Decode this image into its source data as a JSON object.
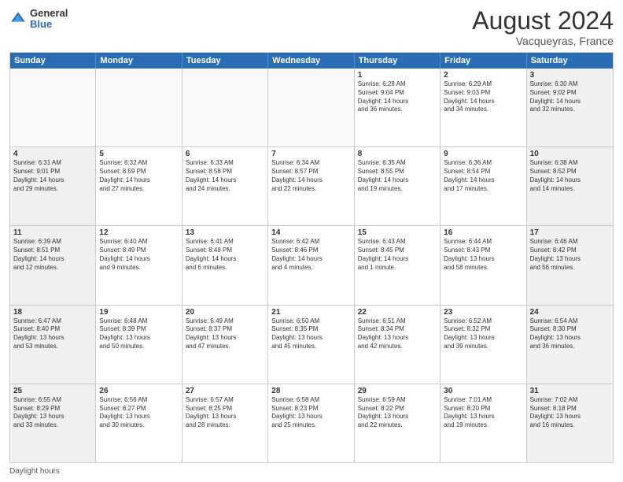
{
  "header": {
    "logo": {
      "general": "General",
      "blue": "Blue"
    },
    "month_year": "August 2024",
    "location": "Vacqueyras, France"
  },
  "days_of_week": [
    "Sunday",
    "Monday",
    "Tuesday",
    "Wednesday",
    "Thursday",
    "Friday",
    "Saturday"
  ],
  "footer": {
    "label": "Daylight hours"
  },
  "weeks": [
    [
      {
        "day": "",
        "info": ""
      },
      {
        "day": "",
        "info": ""
      },
      {
        "day": "",
        "info": ""
      },
      {
        "day": "",
        "info": ""
      },
      {
        "day": "1",
        "info": "Sunrise: 6:28 AM\nSunset: 9:04 PM\nDaylight: 14 hours\nand 36 minutes."
      },
      {
        "day": "2",
        "info": "Sunrise: 6:29 AM\nSunset: 9:03 PM\nDaylight: 14 hours\nand 34 minutes."
      },
      {
        "day": "3",
        "info": "Sunrise: 6:30 AM\nSunset: 9:02 PM\nDaylight: 14 hours\nand 32 minutes."
      }
    ],
    [
      {
        "day": "4",
        "info": "Sunrise: 6:31 AM\nSunset: 9:01 PM\nDaylight: 14 hours\nand 29 minutes."
      },
      {
        "day": "5",
        "info": "Sunrise: 6:32 AM\nSunset: 8:59 PM\nDaylight: 14 hours\nand 27 minutes."
      },
      {
        "day": "6",
        "info": "Sunrise: 6:33 AM\nSunset: 8:58 PM\nDaylight: 14 hours\nand 24 minutes."
      },
      {
        "day": "7",
        "info": "Sunrise: 6:34 AM\nSunset: 8:57 PM\nDaylight: 14 hours\nand 22 minutes."
      },
      {
        "day": "8",
        "info": "Sunrise: 6:35 AM\nSunset: 8:55 PM\nDaylight: 14 hours\nand 19 minutes."
      },
      {
        "day": "9",
        "info": "Sunrise: 6:36 AM\nSunset: 8:54 PM\nDaylight: 14 hours\nand 17 minutes."
      },
      {
        "day": "10",
        "info": "Sunrise: 6:38 AM\nSunset: 8:52 PM\nDaylight: 14 hours\nand 14 minutes."
      }
    ],
    [
      {
        "day": "11",
        "info": "Sunrise: 6:39 AM\nSunset: 8:51 PM\nDaylight: 14 hours\nand 12 minutes."
      },
      {
        "day": "12",
        "info": "Sunrise: 6:40 AM\nSunset: 8:49 PM\nDaylight: 14 hours\nand 9 minutes."
      },
      {
        "day": "13",
        "info": "Sunrise: 6:41 AM\nSunset: 8:48 PM\nDaylight: 14 hours\nand 6 minutes."
      },
      {
        "day": "14",
        "info": "Sunrise: 6:42 AM\nSunset: 8:46 PM\nDaylight: 14 hours\nand 4 minutes."
      },
      {
        "day": "15",
        "info": "Sunrise: 6:43 AM\nSunset: 8:45 PM\nDaylight: 14 hours\nand 1 minute."
      },
      {
        "day": "16",
        "info": "Sunrise: 6:44 AM\nSunset: 8:43 PM\nDaylight: 13 hours\nand 58 minutes."
      },
      {
        "day": "17",
        "info": "Sunrise: 6:46 AM\nSunset: 8:42 PM\nDaylight: 13 hours\nand 56 minutes."
      }
    ],
    [
      {
        "day": "18",
        "info": "Sunrise: 6:47 AM\nSunset: 8:40 PM\nDaylight: 13 hours\nand 53 minutes."
      },
      {
        "day": "19",
        "info": "Sunrise: 6:48 AM\nSunset: 8:39 PM\nDaylight: 13 hours\nand 50 minutes."
      },
      {
        "day": "20",
        "info": "Sunrise: 6:49 AM\nSunset: 8:37 PM\nDaylight: 13 hours\nand 47 minutes."
      },
      {
        "day": "21",
        "info": "Sunrise: 6:50 AM\nSunset: 8:35 PM\nDaylight: 13 hours\nand 45 minutes."
      },
      {
        "day": "22",
        "info": "Sunrise: 6:51 AM\nSunset: 8:34 PM\nDaylight: 13 hours\nand 42 minutes."
      },
      {
        "day": "23",
        "info": "Sunrise: 6:52 AM\nSunset: 8:32 PM\nDaylight: 13 hours\nand 39 minutes."
      },
      {
        "day": "24",
        "info": "Sunrise: 6:54 AM\nSunset: 8:30 PM\nDaylight: 13 hours\nand 36 minutes."
      }
    ],
    [
      {
        "day": "25",
        "info": "Sunrise: 6:55 AM\nSunset: 8:29 PM\nDaylight: 13 hours\nand 33 minutes."
      },
      {
        "day": "26",
        "info": "Sunrise: 6:56 AM\nSunset: 8:27 PM\nDaylight: 13 hours\nand 30 minutes."
      },
      {
        "day": "27",
        "info": "Sunrise: 6:57 AM\nSunset: 8:25 PM\nDaylight: 13 hours\nand 28 minutes."
      },
      {
        "day": "28",
        "info": "Sunrise: 6:58 AM\nSunset: 8:23 PM\nDaylight: 13 hours\nand 25 minutes."
      },
      {
        "day": "29",
        "info": "Sunrise: 6:59 AM\nSunset: 8:22 PM\nDaylight: 13 hours\nand 22 minutes."
      },
      {
        "day": "30",
        "info": "Sunrise: 7:01 AM\nSunset: 8:20 PM\nDaylight: 13 hours\nand 19 minutes."
      },
      {
        "day": "31",
        "info": "Sunrise: 7:02 AM\nSunset: 8:18 PM\nDaylight: 13 hours\nand 16 minutes."
      }
    ]
  ]
}
